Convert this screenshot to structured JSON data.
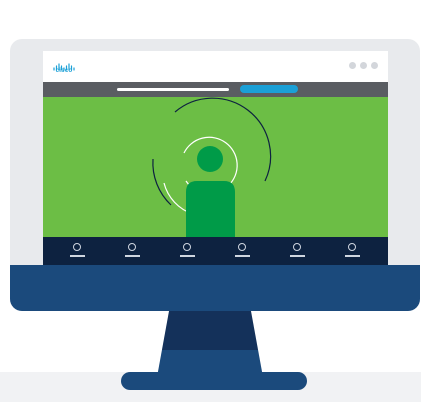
{
  "browser": {
    "logo_text": "cisco",
    "logo_icon": "cisco-bridge-logo",
    "window_controls": [
      "window-dot",
      "window-dot",
      "window-dot"
    ]
  },
  "video": {
    "subject_icon": "person-icon",
    "effect_icon": "signal-rings"
  },
  "nav": {
    "items": [
      "user-icon",
      "user-icon",
      "user-icon",
      "user-icon",
      "user-icon",
      "user-icon"
    ]
  },
  "colors": {
    "brand_blue": "#1ba0d7",
    "video_green": "#6cbe45",
    "person_green": "#009b48",
    "nav_navy": "#0d2240",
    "monitor_blue": "#1b4a7c",
    "toolbar_gray": "#5a5d62"
  }
}
